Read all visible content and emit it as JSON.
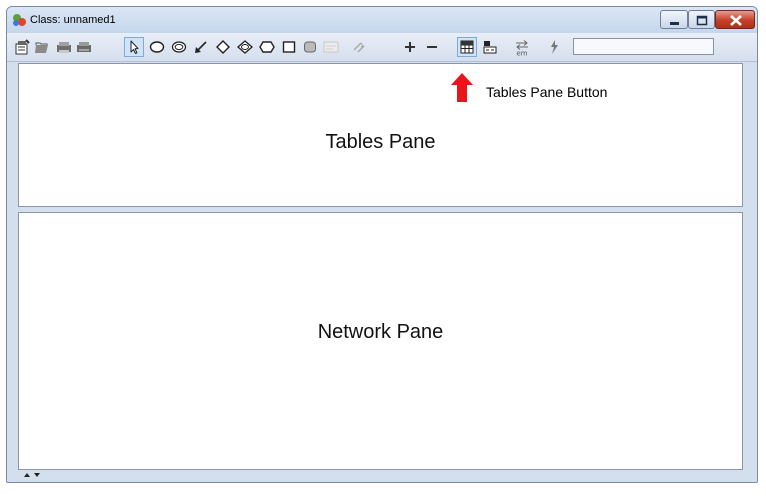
{
  "window": {
    "title": "Class: unnamed1"
  },
  "toolbar": {
    "buttons": [
      {
        "icon": "properties-icon"
      },
      {
        "icon": "open-icon"
      },
      {
        "icon": "print-icon"
      },
      {
        "icon": "print-preview-icon"
      },
      {
        "icon": "select-arrow-icon",
        "selected": true
      },
      {
        "icon": "chance-node-icon"
      },
      {
        "icon": "chance-node-double-icon"
      },
      {
        "icon": "arc-tool-icon"
      },
      {
        "icon": "decision-diamond-icon"
      },
      {
        "icon": "decision-double-icon"
      },
      {
        "icon": "oval-node-icon"
      },
      {
        "icon": "rectangle-node-icon"
      },
      {
        "icon": "rounded-node-icon"
      },
      {
        "icon": "disabled-label-icon"
      },
      {
        "icon": "disabled-arrange-icon"
      },
      {
        "icon": "zoom-in-icon"
      },
      {
        "icon": "zoom-out-icon"
      },
      {
        "icon": "tables-pane-icon",
        "active": true
      },
      {
        "icon": "network-view-icon"
      },
      {
        "icon": "em-learning-icon",
        "sub_label": "em"
      },
      {
        "icon": "compile-lightning-icon"
      }
    ],
    "search_value": ""
  },
  "panes": {
    "tables_label": "Tables Pane",
    "network_label": "Network Pane"
  },
  "annotation": {
    "label": "Tables Pane Button",
    "arrow_color": "#e8161b"
  },
  "colors": {
    "window_frame": "#d4dfee",
    "pane_border": "#8b97a8",
    "close_button": "#c5402a"
  }
}
